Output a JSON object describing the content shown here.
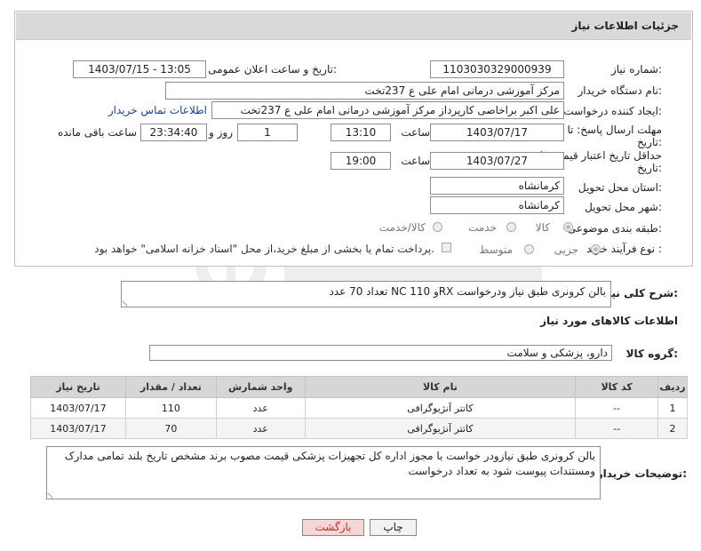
{
  "header": {
    "title": "جزئیات اطلاعات نیاز"
  },
  "form": {
    "need_number_label": "شماره نیاز:",
    "need_number": "1103030329000939",
    "announce_label": "تاریخ و ساعت اعلان عمومی:",
    "announce_value": "1403/07/15 - 13:05",
    "buyer_org_label": "نام دستگاه خریدار:",
    "buyer_org": "مرکز آموزشی درمانی امام علی ع 237تخت",
    "requester_label": "ایجاد کننده درخواست:",
    "requester": "علی اکبر براخاصی کارپرداز  مرکز آموزشی درمانی امام علی ع 237تخت",
    "contact_link": "اطلاعات تماس خریدار",
    "deadline_label_1": "مهلت ارسال پاسخ: تا",
    "deadline_label_2": "تاریخ:",
    "deadline_date": "1403/07/17",
    "time_label": "ساعت",
    "deadline_time": "13:10",
    "days_value": "1",
    "days_label": "روز و",
    "remaining_value": "23:34:40",
    "remaining_label": "ساعت باقی مانده",
    "validity_label_1": "حداقل تاریخ اعتبار قیمت: تا",
    "validity_label_2": "تاریخ:",
    "validity_date": "1403/07/27",
    "validity_time": "19:00",
    "province_label": "استان محل تحویل:",
    "province": "کرمانشاه",
    "city_label": "شهر محل تحویل:",
    "city": "کرمانشاه",
    "category_label": "طبقه بندی موضوعی:",
    "category_options": [
      "کالا",
      "خدمت",
      "کالا/خدمت"
    ],
    "process_label": "نوع فرآیند خرید :",
    "process_options": [
      "جزیی",
      "متوسط"
    ],
    "payment_note": "پرداخت تمام یا بخشی از مبلغ خرید،از محل \"اسناد خزانه اسلامی\" خواهد بود."
  },
  "description": {
    "label": "شرح کلی نیاز:",
    "value": "بالن کرونری طبق نیاز ودرخواست RXو NC 110 تعداد 70 عدد"
  },
  "goods": {
    "section_title": "اطلاعات کالاهای مورد نیاز",
    "group_label": "گروه کالا:",
    "group_value": "دارو، پزشکی و سلامت",
    "columns": [
      "ردیف",
      "کد کالا",
      "نام کالا",
      "واحد شمارش",
      "تعداد / مقدار",
      "تاریخ نیاز"
    ],
    "rows": [
      [
        "1",
        "--",
        "کاتتر آنژیوگرافی",
        "عدد",
        "110",
        "1403/07/17"
      ],
      [
        "2",
        "--",
        "کاتتر آنژیوگرافی",
        "عدد",
        "70",
        "1403/07/17"
      ]
    ]
  },
  "buyer_notes": {
    "label": "توضیحات خریدار:",
    "value": "بالن کرونری طبق نیازودر خواست با مجوز اداره کل تجهیزات پزشکی قیمت مصوب برند مشخص تاریخ بلند تمامی مدارک ومستندات پیوست شود به تعداد درخواست"
  },
  "buttons": {
    "print": "چاپ",
    "back": "بازگشت"
  },
  "colors": {
    "link": "#1a3fa8",
    "back_bg": "#f7d6d6",
    "back_text": "#c23030"
  }
}
